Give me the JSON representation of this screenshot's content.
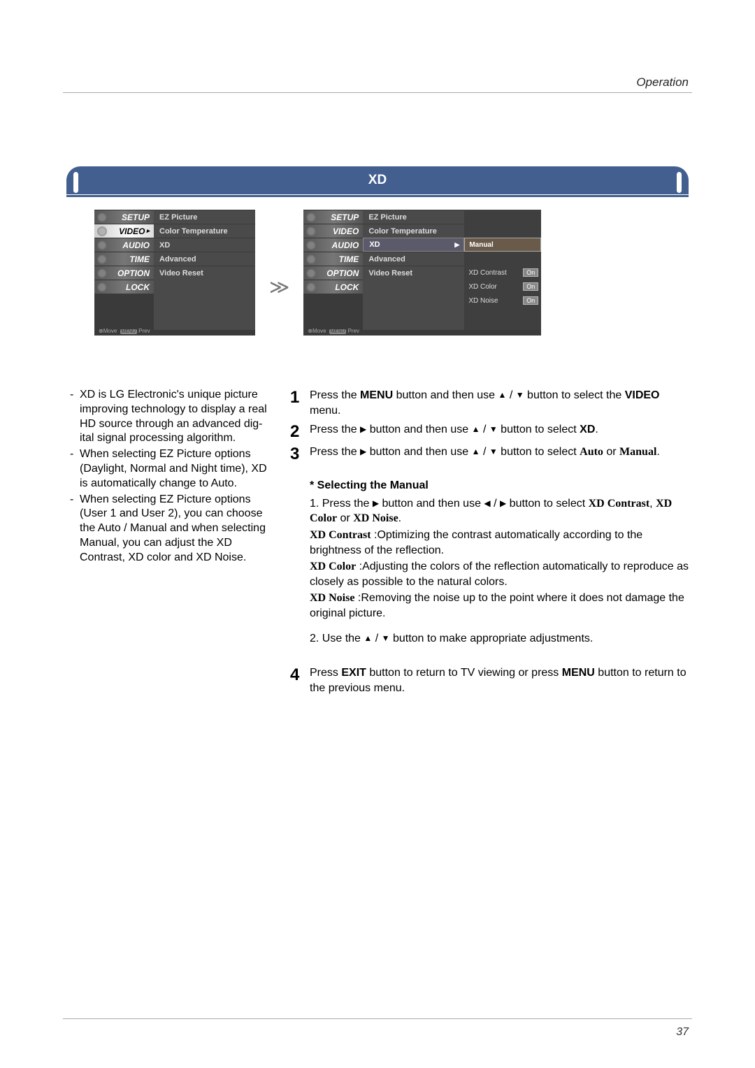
{
  "header": {
    "section": "Operation"
  },
  "title": "XD",
  "osd": {
    "tabs": [
      "SETUP",
      "VIDEO",
      "AUDIO",
      "TIME",
      "OPTION",
      "LOCK"
    ],
    "sel_tab": 1,
    "menu_items": [
      "EZ Picture",
      "Color Temperature",
      "XD",
      "Advanced",
      "Video Reset"
    ],
    "footer_move": "Move",
    "footer_prev": "Prev",
    "footer_menu_key": "MENU",
    "sel_item_idx": 2
  },
  "osd2_extra": {
    "mode": "Manual",
    "params": [
      {
        "label": "XD Contrast",
        "value": "On"
      },
      {
        "label": "XD Color",
        "value": "On"
      },
      {
        "label": "XD Noise",
        "value": "On"
      }
    ]
  },
  "arrow": "≫",
  "left_notes": [
    "XD is LG Electronic's unique picture improving technology to display a real HD source through an advanced dig-ital signal processing algorithm.",
    "When selecting EZ Picture options (Daylight, Normal and Night time), XD is automatically change to Auto.",
    "When selecting EZ Picture options (User 1 and User 2), you can choose the Auto / Manual and when selecting Manual, you can adjust the XD Contrast, XD color and XD Noise."
  ],
  "steps": {
    "s1": {
      "pre": "Press the ",
      "menu_bold": "MENU",
      "mid": " button and then use ",
      "post": " button to select the ",
      "video_bold": "VIDEO",
      "end": " menu."
    },
    "s2": {
      "pre": "Press the ",
      "mid": " button and then use ",
      "post": " button to select ",
      "xd_bold": "XD",
      "end": "."
    },
    "s3": {
      "pre": "Press the ",
      "mid": " button and then use ",
      "post": " button to select ",
      "auto_bold": "Auto",
      "or": " or ",
      "manual_bold": "Manual",
      "end": "."
    },
    "sub": {
      "title": "* Selecting the Manual",
      "l1_pre": "1. Press the ",
      "l1_mid": " button and then use ",
      "l1_post": " button to select ",
      "l1_xd_contrast": "XD Contrast",
      "l1_comma": ", ",
      "l1_xd_color": "XD Color",
      "l1_or": " or ",
      "l1_xd_noise": "XD Noise",
      "l1_end": ".",
      "d_contrast_label": "XD Contrast",
      "d_contrast": " :Optimizing the contrast automatically according to the brightness of the reflection.",
      "d_color_label": "XD Color",
      "d_color": " :Adjusting the colors of the reflection automatically to reproduce as closely as possible to the natural colors.",
      "d_noise_label": "XD Noise",
      "d_noise": " :Removing the noise up to the point where it does not damage the original picture.",
      "l2_pre": "2. Use the ",
      "l2_post": " button to make appropriate adjustments."
    },
    "s4": {
      "pre": "Press ",
      "exit_bold": "EXIT",
      "mid": " button to return to TV viewing or press ",
      "menu_bold": "MENU",
      "end": " button to return to the previous menu."
    }
  },
  "page_number": "37"
}
